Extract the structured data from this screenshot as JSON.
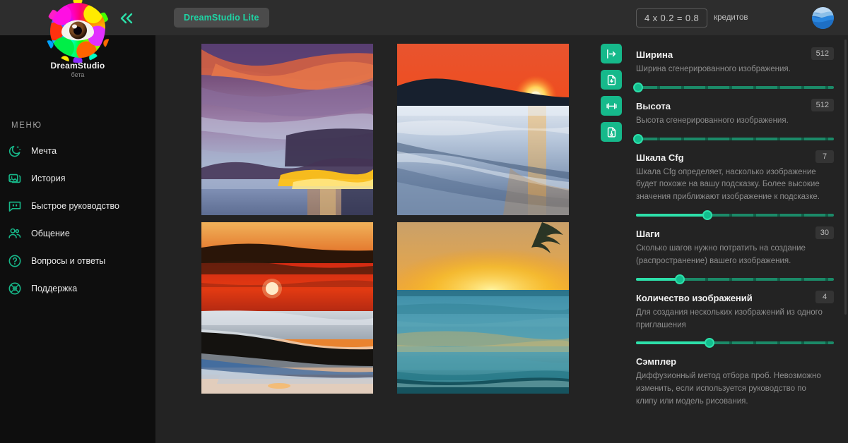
{
  "brand": {
    "name": "DreamStudio",
    "sub": "бета",
    "logo_icon": "rainbow-splatter-eye-logo"
  },
  "sidebar": {
    "collapse_icon": "double-chevron-left-icon",
    "menu_heading": "МЕНЮ",
    "items": [
      {
        "label": "Мечта",
        "icon": "moon-sparkle-icon"
      },
      {
        "label": "История",
        "icon": "image-stack-icon"
      },
      {
        "label": "Быстрое руководство",
        "icon": "quote-bubble-icon"
      },
      {
        "label": "Общение",
        "icon": "people-group-icon"
      },
      {
        "label": "Вопросы и ответы",
        "icon": "question-circle-icon"
      },
      {
        "label": "Поддержка",
        "icon": "lifebuoy-icon"
      }
    ]
  },
  "topbar": {
    "lite_badge": "DreamStudio Lite",
    "credits_value": "4 x 0.2 = 0.8",
    "credits_label": "кредитов",
    "avatar_icon": "user-avatar-blue-globe"
  },
  "gallery": {
    "tiles": [
      {
        "name": "sunset-purple-clouds-ocean"
      },
      {
        "name": "red-sunset-headland-waves"
      },
      {
        "name": "orange-red-sunset-breaking-wave"
      },
      {
        "name": "golden-sunset-calm-sea-palm"
      }
    ],
    "actions": [
      {
        "icon": "arrow-into-bar-icon",
        "name": "send-to-prompt-button"
      },
      {
        "icon": "file-download-icon",
        "name": "download-image-button"
      },
      {
        "icon": "dumbbell-icon",
        "name": "variations-button"
      },
      {
        "icon": "file-seed-icon",
        "name": "copy-seed-button"
      }
    ]
  },
  "controls": [
    {
      "title": "Ширина",
      "value": "512",
      "desc": "Ширина сгенерированного изображения.",
      "percent": 1,
      "name": "width-slider"
    },
    {
      "title": "Высота",
      "value": "512",
      "desc": "Высота сгенерированного изображения.",
      "percent": 1,
      "name": "height-slider"
    },
    {
      "title": "Шкала Cfg",
      "value": "7",
      "desc": "Шкала Cfg определяет, насколько изображение будет похоже на вашу подсказку. Более высокие значения приближают изображение к подсказке.",
      "percent": 36,
      "name": "cfg-scale-slider"
    },
    {
      "title": "Шаги",
      "value": "30",
      "desc": "Сколько шагов нужно потратить на создание (распространение) вашего изображения.",
      "percent": 22,
      "name": "steps-slider"
    },
    {
      "title": "Количество изображений",
      "value": "4",
      "desc": "Для создания нескольких изображений из одного приглашения",
      "percent": 37,
      "name": "image-count-slider"
    },
    {
      "title": "Сэмплер",
      "value": "",
      "desc": "Диффузионный метод отбора проб. Невозможно изменить, если используется руководство по клипу или модель рисования.",
      "percent": -1,
      "name": "sampler-control"
    }
  ],
  "colors": {
    "accent": "#2de0aa",
    "accent_dark": "#16b98b",
    "sidebar_bg": "#0e0e0e",
    "topbar_bg": "#2d2d2d",
    "canvas_bg": "#232323"
  }
}
